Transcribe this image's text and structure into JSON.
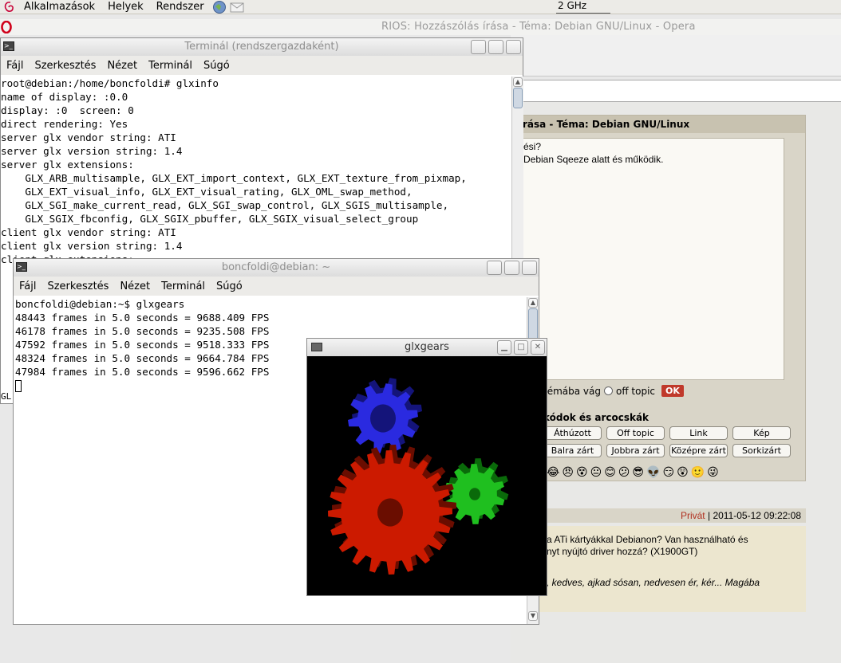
{
  "panel": {
    "menus": [
      "Alkalmazások",
      "Helyek",
      "Rendszer"
    ],
    "cpu_freq": "2 GHz"
  },
  "opera": {
    "title": "RIOS: Hozzászólás írása - Téma: Debian GNU/Linux - Opera",
    "forum": {
      "header": "rása - Téma: Debian GNU/Linux",
      "text_lines": [
        "ési?",
        "Debian Sqeeze alatt és működik."
      ],
      "option_label": "témába vág",
      "offtopic_label": "off topic",
      "ok_label": "OK",
      "codes_title": "kódok és arcocskák",
      "buttons_row1": [
        "Áthúzott",
        "Off topic",
        "Link",
        "Kép"
      ],
      "buttons_row2": [
        "Balra zárt",
        "Jobbra zárt",
        "Középre zárt",
        "Sorkizárt"
      ],
      "smilies": [
        "😂",
        "😠",
        "😵",
        "😐",
        "😊",
        "😕",
        "😎",
        "👽",
        "😏",
        "😲",
        "🙂",
        "😜"
      ]
    },
    "post": {
      "private_label": "Privát",
      "separator": "|",
      "date": "2011-05-12 09:22:08",
      "lines": [
        "a ATi kártyákkal Debianon? Van használható és",
        "nyt nyújtó driver hozzá? (X1900GT)"
      ],
      "italic_line": ", kedves, ajkad sósan, nedvesen ér, kér... Magába"
    }
  },
  "root_terminal": {
    "title": "Terminál (rendszergazdaként)",
    "menu": [
      "Fájl",
      "Szerkesztés",
      "Nézet",
      "Terminál",
      "Súgó"
    ],
    "lines": [
      "root@debian:/home/boncfoldi# glxinfo",
      "name of display: :0.0",
      "display: :0  screen: 0",
      "direct rendering: Yes",
      "server glx vendor string: ATI",
      "server glx version string: 1.4",
      "server glx extensions:",
      "    GLX_ARB_multisample, GLX_EXT_import_context, GLX_EXT_texture_from_pixmap,",
      "    GLX_EXT_visual_info, GLX_EXT_visual_rating, GLX_OML_swap_method,",
      "    GLX_SGI_make_current_read, GLX_SGI_swap_control, GLX_SGIS_multisample,",
      "    GLX_SGIX_fbconfig, GLX_SGIX_pbuffer, GLX_SGIX_visual_select_group",
      "client glx vendor string: ATI",
      "client glx version string: 1.4",
      "client glx extensions:"
    ],
    "fragment": "GL"
  },
  "user_terminal": {
    "title": "boncfoldi@debian: ~",
    "menu": [
      "Fájl",
      "Szerkesztés",
      "Nézet",
      "Terminál",
      "Súgó"
    ],
    "lines": [
      "boncfoldi@debian:~$ glxgears",
      "48443 frames in 5.0 seconds = 9688.409 FPS",
      "46178 frames in 5.0 seconds = 9235.508 FPS",
      "47592 frames in 5.0 seconds = 9518.333 FPS",
      "48324 frames in 5.0 seconds = 9664.784 FPS",
      "47984 frames in 5.0 seconds = 9596.662 FPS"
    ]
  },
  "glxgears": {
    "title": "glxgears",
    "colors": {
      "red": "#cc1a00",
      "green": "#1fbf1f",
      "blue": "#2a2ae0"
    }
  }
}
